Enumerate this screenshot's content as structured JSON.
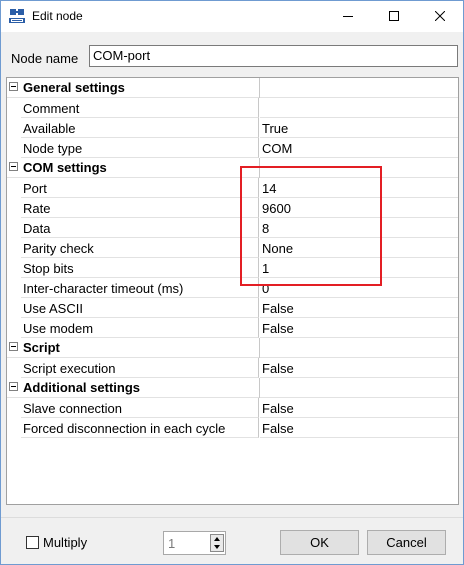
{
  "window": {
    "title": "Edit node",
    "icon": "opc-server-icon"
  },
  "node_name": {
    "label": "Node name",
    "value": "COM-port"
  },
  "properties": [
    {
      "type": "category",
      "name": "General settings"
    },
    {
      "type": "prop",
      "name": "Comment",
      "value": ""
    },
    {
      "type": "prop",
      "name": "Available",
      "value": "True"
    },
    {
      "type": "prop",
      "name": "Node type",
      "value": "COM"
    },
    {
      "type": "category",
      "name": "COM settings"
    },
    {
      "type": "prop",
      "name": "Port",
      "value": "14"
    },
    {
      "type": "prop",
      "name": "Rate",
      "value": "9600"
    },
    {
      "type": "prop",
      "name": "Data",
      "value": "8"
    },
    {
      "type": "prop",
      "name": "Parity check",
      "value": "None"
    },
    {
      "type": "prop",
      "name": "Stop bits",
      "value": "1"
    },
    {
      "type": "prop",
      "name": "Inter-character timeout (ms)",
      "value": "0"
    },
    {
      "type": "prop",
      "name": "Use ASCII",
      "value": "False"
    },
    {
      "type": "prop",
      "name": "Use modem",
      "value": "False"
    },
    {
      "type": "category",
      "name": "Script"
    },
    {
      "type": "prop",
      "name": "Script execution",
      "value": "False"
    },
    {
      "type": "category",
      "name": "Additional settings"
    },
    {
      "type": "prop",
      "name": "Slave connection",
      "value": "False"
    },
    {
      "type": "prop",
      "name": "Forced disconnection in each cycle",
      "value": "False"
    }
  ],
  "footer": {
    "multiply_label": "Multiply",
    "multiply_checked": false,
    "count_value": "1",
    "ok_label": "OK",
    "cancel_label": "Cancel"
  },
  "colors": {
    "highlight": "#e31e24",
    "window_border": "#6f9bd1"
  }
}
